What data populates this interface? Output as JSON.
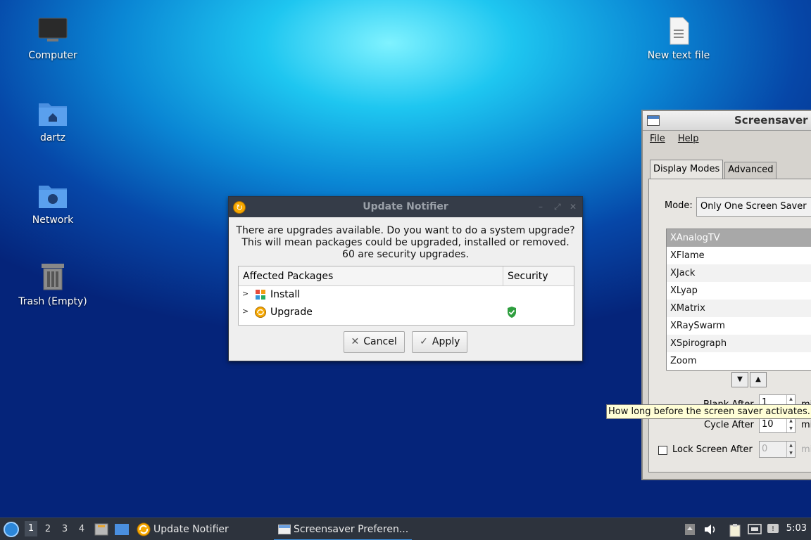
{
  "desktop": {
    "icons": [
      {
        "label": "Computer"
      },
      {
        "label": "dartz"
      },
      {
        "label": "Network"
      },
      {
        "label": "Trash (Empty)"
      },
      {
        "label": "New text file"
      }
    ]
  },
  "screensaver": {
    "title": "Screensaver I",
    "menu": [
      "File",
      "Help"
    ],
    "tabs": [
      "Display Modes",
      "Advanced"
    ],
    "mode_label": "Mode:",
    "mode_value": "Only One Screen Saver",
    "modes": [
      "XAnalogTV",
      "XFlame",
      "XJack",
      "XLyap",
      "XMatrix",
      "XRaySwarm",
      "XSpirograph",
      "Zoom"
    ],
    "selected_mode": "XAnalogTV",
    "blank_after_label": "Blank After",
    "blank_after_value": "1",
    "cycle_after_label": "Cycle After",
    "cycle_after_value": "10",
    "lock_label": "Lock Screen After",
    "lock_value": "0",
    "unit_partial": "mi"
  },
  "tooltip": "How long before the screen saver activates.",
  "update_notifier": {
    "title": "Update Notifier",
    "message_line1": "There are upgrades available. Do you want to do a system upgrade?",
    "message_line2": "This will mean packages could be upgraded, installed or removed.",
    "message_line3": "60 are security upgrades.",
    "col_packages": "Affected Packages",
    "col_security": "Security",
    "rows": [
      {
        "label": "Install"
      },
      {
        "label": "Upgrade"
      }
    ],
    "cancel_label": "Cancel",
    "apply_label": "Apply"
  },
  "taskbar": {
    "workspaces": [
      "1",
      "2",
      "3",
      "4"
    ],
    "tasks": [
      {
        "label": "Update Notifier"
      },
      {
        "label": "Screensaver Preferen..."
      }
    ],
    "clock": "5:03"
  }
}
